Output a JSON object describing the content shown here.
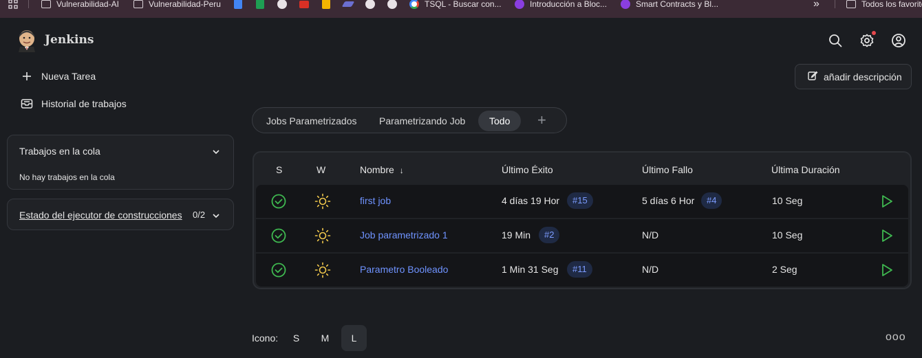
{
  "bookmarks": [
    {
      "label": "",
      "icon": "apps-grid-icon"
    },
    {
      "label": "Vulnerabilidad-AI",
      "icon": "folder-icon"
    },
    {
      "label": "Vulnerabilidad-Peru",
      "icon": "folder-icon"
    },
    {
      "label": "",
      "icon": "google-docs-icon"
    },
    {
      "label": "",
      "icon": "google-sheets-icon"
    },
    {
      "label": "",
      "icon": "github-icon"
    },
    {
      "label": "",
      "icon": "gmail-icon"
    },
    {
      "label": "",
      "icon": "google-slides-icon"
    },
    {
      "label": "",
      "icon": "bookmark-app-icon"
    },
    {
      "label": "",
      "icon": "github-icon"
    },
    {
      "label": "",
      "icon": "github-icon"
    },
    {
      "label": "TSQL - Buscar con...",
      "icon": "google-icon"
    },
    {
      "label": "Introducción a Bloc...",
      "icon": "course-icon"
    },
    {
      "label": "Smart Contracts y Bl...",
      "icon": "course-icon"
    },
    {
      "label": "»",
      "icon": "more-bookmarks-icon"
    },
    {
      "label": "Todos los favoritos",
      "icon": "folder-icon"
    }
  ],
  "header": {
    "brand": "Jenkins"
  },
  "sidebar": {
    "new_task": "Nueva Tarea",
    "history": "Historial de trabajos",
    "queue_title": "Trabajos en la cola",
    "queue_empty": "No hay trabajos en la cola",
    "executor_title": "Estado del ejecutor de construcciones",
    "executor_count": "0/2"
  },
  "main": {
    "add_description": "añadir descripción",
    "tabs": [
      {
        "label": "Jobs Parametrizados",
        "active": false
      },
      {
        "label": "Parametrizando Job",
        "active": false
      },
      {
        "label": "Todo",
        "active": true
      }
    ],
    "tab_add": "+",
    "table": {
      "headers": {
        "s": "S",
        "w": "W",
        "name": "Nombre",
        "sort_arrow": "↓",
        "last_success": "Último Éxito",
        "last_failure": "Último Fallo",
        "last_duration": "Última Duración"
      },
      "rows": [
        {
          "name": "first job",
          "last_success": "4 días 19 Hor",
          "success_build": "#15",
          "last_failure": "5 días 6 Hor",
          "failure_build": "#4",
          "duration": "10 Seg"
        },
        {
          "name": "Job parametrizado 1",
          "last_success": "19 Min",
          "success_build": "#2",
          "last_failure": "N/D",
          "failure_build": "",
          "duration": "10 Seg"
        },
        {
          "name": "Parametro Booleado",
          "last_success": "1 Min 31 Seg",
          "success_build": "#11",
          "last_failure": "N/D",
          "failure_build": "",
          "duration": "2 Seg"
        }
      ]
    },
    "icon_size": {
      "label": "Icono:",
      "options": [
        "S",
        "M",
        "L"
      ],
      "selected": "L"
    },
    "more": "ooo"
  },
  "colors": {
    "background": "#1b1d21",
    "link": "#6f93ff",
    "success": "#3fb950",
    "weather": "#f2c94c",
    "bookmark_bar": "#3b2a35"
  }
}
